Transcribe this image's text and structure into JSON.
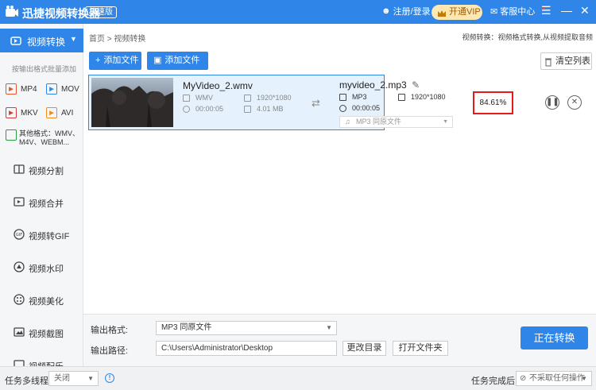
{
  "app": {
    "title": "迅捷视频转换器",
    "badge": "极速版"
  },
  "titlebar": {
    "login": "注册/登录",
    "vip": "开通VIP",
    "support": "客服中心"
  },
  "sidebar": {
    "active": "视频转换",
    "batch_hint": "按输出格式批量添加",
    "formats": [
      "MP4",
      "MOV",
      "MKV",
      "AVI"
    ],
    "other_formats": "其他格式：WMV、M4V、WEBM...",
    "items": [
      "视频分割",
      "视频合并",
      "视频转GIF",
      "视频水印",
      "视频美化",
      "视频截图",
      "视频配乐"
    ]
  },
  "breadcrumb": {
    "home": "首页",
    "sep": ">",
    "current": "视频转换"
  },
  "conv_hint": "视频转换：视频格式转换,从视频提取音频",
  "toolbar": {
    "add_file": "添加文件",
    "add_folder": "添加文件夹",
    "clear": "清空列表"
  },
  "file": {
    "src_name": "MyVideo_2.wmv",
    "src_format": "WMV",
    "src_resolution": "1920*1080",
    "src_duration": "00:00:05",
    "src_size": "4.01 MB",
    "out_name": "myvideo_2.mp3",
    "out_format": "MP3",
    "out_resolution": "1920*1080",
    "out_duration": "00:00:05",
    "out_select": "MP3  同原文件",
    "progress": "84.61%"
  },
  "bottom": {
    "format_label": "输出格式:",
    "format_value": "MP3  同原文件",
    "path_label": "输出路径:",
    "path_value": "C:\\Users\\Administrator\\Desktop",
    "change_dir": "更改目录",
    "open_folder": "打开文件夹",
    "start": "正在转换"
  },
  "status": {
    "multi_label": "任务多线程",
    "multi_value": "关闭",
    "after_label": "任务完成后",
    "after_value": "不采取任何操作"
  },
  "colors": {
    "accent": "#2f86e8",
    "highlight": "#e41b1b"
  }
}
